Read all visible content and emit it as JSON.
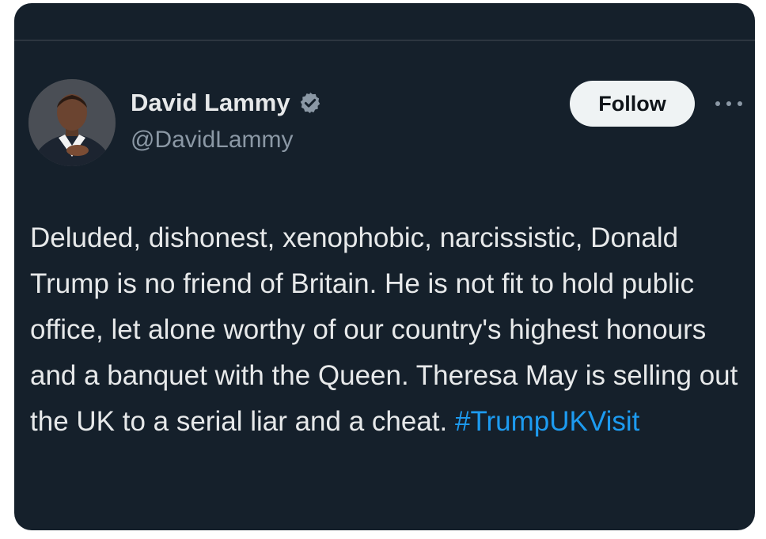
{
  "author": {
    "name": "David Lammy",
    "handle": "@DavidLammy",
    "verified": true
  },
  "actions": {
    "follow_label": "Follow",
    "more_icon": "more-horizontal-icon"
  },
  "tweet": {
    "text": "Deluded, dishonest, xenophobic, narcissistic, Donald Trump is no friend of Britain. He is not fit to hold public office, let alone worthy of our country's highest honours and a banquet with the Queen. Theresa May is selling out the UK to a serial liar and a cheat.",
    "hashtag": "#TrumpUKVisit"
  },
  "colors": {
    "background": "#15202b",
    "text": "#e7e9ea",
    "secondary_text": "#8b98a5",
    "link": "#1d9bf0",
    "follow_button_bg": "#eff3f4"
  }
}
